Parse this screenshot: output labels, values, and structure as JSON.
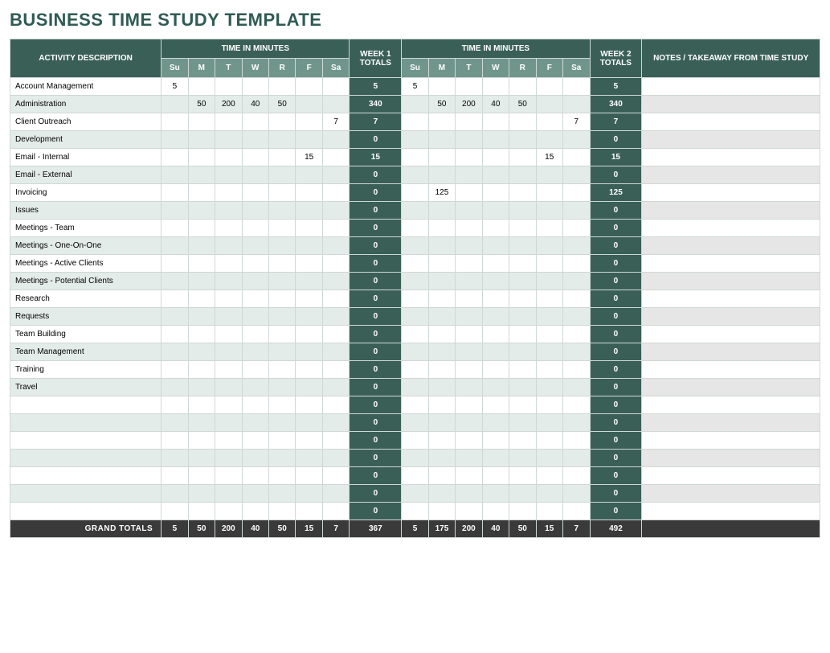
{
  "title": "BUSINESS TIME STUDY TEMPLATE",
  "headers": {
    "activity": "ACTIVITY DESCRIPTION",
    "time_in_minutes": "TIME IN MINUTES",
    "week1_totals": "WEEK 1 TOTALS",
    "week2_totals": "WEEK 2 TOTALS",
    "notes": "NOTES / TAKEAWAY FROM TIME STUDY",
    "days": [
      "Su",
      "M",
      "T",
      "W",
      "R",
      "F",
      "Sa"
    ],
    "grand_totals": "GRAND TOTALS"
  },
  "rows": [
    {
      "desc": "Account Management",
      "w1": [
        "5",
        "",
        "",
        "",
        "",
        "",
        ""
      ],
      "t1": "5",
      "w2": [
        "5",
        "",
        "",
        "",
        "",
        "",
        ""
      ],
      "t2": "5",
      "notes": ""
    },
    {
      "desc": "Administration",
      "w1": [
        "",
        "50",
        "200",
        "40",
        "50",
        "",
        ""
      ],
      "t1": "340",
      "w2": [
        "",
        "50",
        "200",
        "40",
        "50",
        "",
        ""
      ],
      "t2": "340",
      "notes": ""
    },
    {
      "desc": "Client Outreach",
      "w1": [
        "",
        "",
        "",
        "",
        "",
        "",
        "7"
      ],
      "t1": "7",
      "w2": [
        "",
        "",
        "",
        "",
        "",
        "",
        "7"
      ],
      "t2": "7",
      "notes": ""
    },
    {
      "desc": "Development",
      "w1": [
        "",
        "",
        "",
        "",
        "",
        "",
        ""
      ],
      "t1": "0",
      "w2": [
        "",
        "",
        "",
        "",
        "",
        "",
        ""
      ],
      "t2": "0",
      "notes": ""
    },
    {
      "desc": "Email - Internal",
      "w1": [
        "",
        "",
        "",
        "",
        "",
        "15",
        ""
      ],
      "t1": "15",
      "w2": [
        "",
        "",
        "",
        "",
        "",
        "15",
        ""
      ],
      "t2": "15",
      "notes": ""
    },
    {
      "desc": "Email - External",
      "w1": [
        "",
        "",
        "",
        "",
        "",
        "",
        ""
      ],
      "t1": "0",
      "w2": [
        "",
        "",
        "",
        "",
        "",
        "",
        ""
      ],
      "t2": "0",
      "notes": ""
    },
    {
      "desc": "Invoicing",
      "w1": [
        "",
        "",
        "",
        "",
        "",
        "",
        ""
      ],
      "t1": "0",
      "w2": [
        "",
        "125",
        "",
        "",
        "",
        "",
        ""
      ],
      "t2": "125",
      "notes": ""
    },
    {
      "desc": "Issues",
      "w1": [
        "",
        "",
        "",
        "",
        "",
        "",
        ""
      ],
      "t1": "0",
      "w2": [
        "",
        "",
        "",
        "",
        "",
        "",
        ""
      ],
      "t2": "0",
      "notes": ""
    },
    {
      "desc": "Meetings - Team",
      "w1": [
        "",
        "",
        "",
        "",
        "",
        "",
        ""
      ],
      "t1": "0",
      "w2": [
        "",
        "",
        "",
        "",
        "",
        "",
        ""
      ],
      "t2": "0",
      "notes": ""
    },
    {
      "desc": "Meetings - One-On-One",
      "w1": [
        "",
        "",
        "",
        "",
        "",
        "",
        ""
      ],
      "t1": "0",
      "w2": [
        "",
        "",
        "",
        "",
        "",
        "",
        ""
      ],
      "t2": "0",
      "notes": ""
    },
    {
      "desc": "Meetings - Active Clients",
      "w1": [
        "",
        "",
        "",
        "",
        "",
        "",
        ""
      ],
      "t1": "0",
      "w2": [
        "",
        "",
        "",
        "",
        "",
        "",
        ""
      ],
      "t2": "0",
      "notes": ""
    },
    {
      "desc": "Meetings - Potential Clients",
      "w1": [
        "",
        "",
        "",
        "",
        "",
        "",
        ""
      ],
      "t1": "0",
      "w2": [
        "",
        "",
        "",
        "",
        "",
        "",
        ""
      ],
      "t2": "0",
      "notes": ""
    },
    {
      "desc": "Research",
      "w1": [
        "",
        "",
        "",
        "",
        "",
        "",
        ""
      ],
      "t1": "0",
      "w2": [
        "",
        "",
        "",
        "",
        "",
        "",
        ""
      ],
      "t2": "0",
      "notes": ""
    },
    {
      "desc": "Requests",
      "w1": [
        "",
        "",
        "",
        "",
        "",
        "",
        ""
      ],
      "t1": "0",
      "w2": [
        "",
        "",
        "",
        "",
        "",
        "",
        ""
      ],
      "t2": "0",
      "notes": ""
    },
    {
      "desc": "Team Building",
      "w1": [
        "",
        "",
        "",
        "",
        "",
        "",
        ""
      ],
      "t1": "0",
      "w2": [
        "",
        "",
        "",
        "",
        "",
        "",
        ""
      ],
      "t2": "0",
      "notes": ""
    },
    {
      "desc": "Team Management",
      "w1": [
        "",
        "",
        "",
        "",
        "",
        "",
        ""
      ],
      "t1": "0",
      "w2": [
        "",
        "",
        "",
        "",
        "",
        "",
        ""
      ],
      "t2": "0",
      "notes": ""
    },
    {
      "desc": "Training",
      "w1": [
        "",
        "",
        "",
        "",
        "",
        "",
        ""
      ],
      "t1": "0",
      "w2": [
        "",
        "",
        "",
        "",
        "",
        "",
        ""
      ],
      "t2": "0",
      "notes": ""
    },
    {
      "desc": "Travel",
      "w1": [
        "",
        "",
        "",
        "",
        "",
        "",
        ""
      ],
      "t1": "0",
      "w2": [
        "",
        "",
        "",
        "",
        "",
        "",
        ""
      ],
      "t2": "0",
      "notes": ""
    },
    {
      "desc": "",
      "w1": [
        "",
        "",
        "",
        "",
        "",
        "",
        ""
      ],
      "t1": "0",
      "w2": [
        "",
        "",
        "",
        "",
        "",
        "",
        ""
      ],
      "t2": "0",
      "notes": ""
    },
    {
      "desc": "",
      "w1": [
        "",
        "",
        "",
        "",
        "",
        "",
        ""
      ],
      "t1": "0",
      "w2": [
        "",
        "",
        "",
        "",
        "",
        "",
        ""
      ],
      "t2": "0",
      "notes": ""
    },
    {
      "desc": "",
      "w1": [
        "",
        "",
        "",
        "",
        "",
        "",
        ""
      ],
      "t1": "0",
      "w2": [
        "",
        "",
        "",
        "",
        "",
        "",
        ""
      ],
      "t2": "0",
      "notes": ""
    },
    {
      "desc": "",
      "w1": [
        "",
        "",
        "",
        "",
        "",
        "",
        ""
      ],
      "t1": "0",
      "w2": [
        "",
        "",
        "",
        "",
        "",
        "",
        ""
      ],
      "t2": "0",
      "notes": ""
    },
    {
      "desc": "",
      "w1": [
        "",
        "",
        "",
        "",
        "",
        "",
        ""
      ],
      "t1": "0",
      "w2": [
        "",
        "",
        "",
        "",
        "",
        "",
        ""
      ],
      "t2": "0",
      "notes": ""
    },
    {
      "desc": "",
      "w1": [
        "",
        "",
        "",
        "",
        "",
        "",
        ""
      ],
      "t1": "0",
      "w2": [
        "",
        "",
        "",
        "",
        "",
        "",
        ""
      ],
      "t2": "0",
      "notes": ""
    },
    {
      "desc": "",
      "w1": [
        "",
        "",
        "",
        "",
        "",
        "",
        ""
      ],
      "t1": "0",
      "w2": [
        "",
        "",
        "",
        "",
        "",
        "",
        ""
      ],
      "t2": "0",
      "notes": ""
    }
  ],
  "grand": {
    "w1": [
      "5",
      "50",
      "200",
      "40",
      "50",
      "15",
      "7"
    ],
    "t1": "367",
    "w2": [
      "5",
      "175",
      "200",
      "40",
      "50",
      "15",
      "7"
    ],
    "t2": "492",
    "notes": ""
  }
}
